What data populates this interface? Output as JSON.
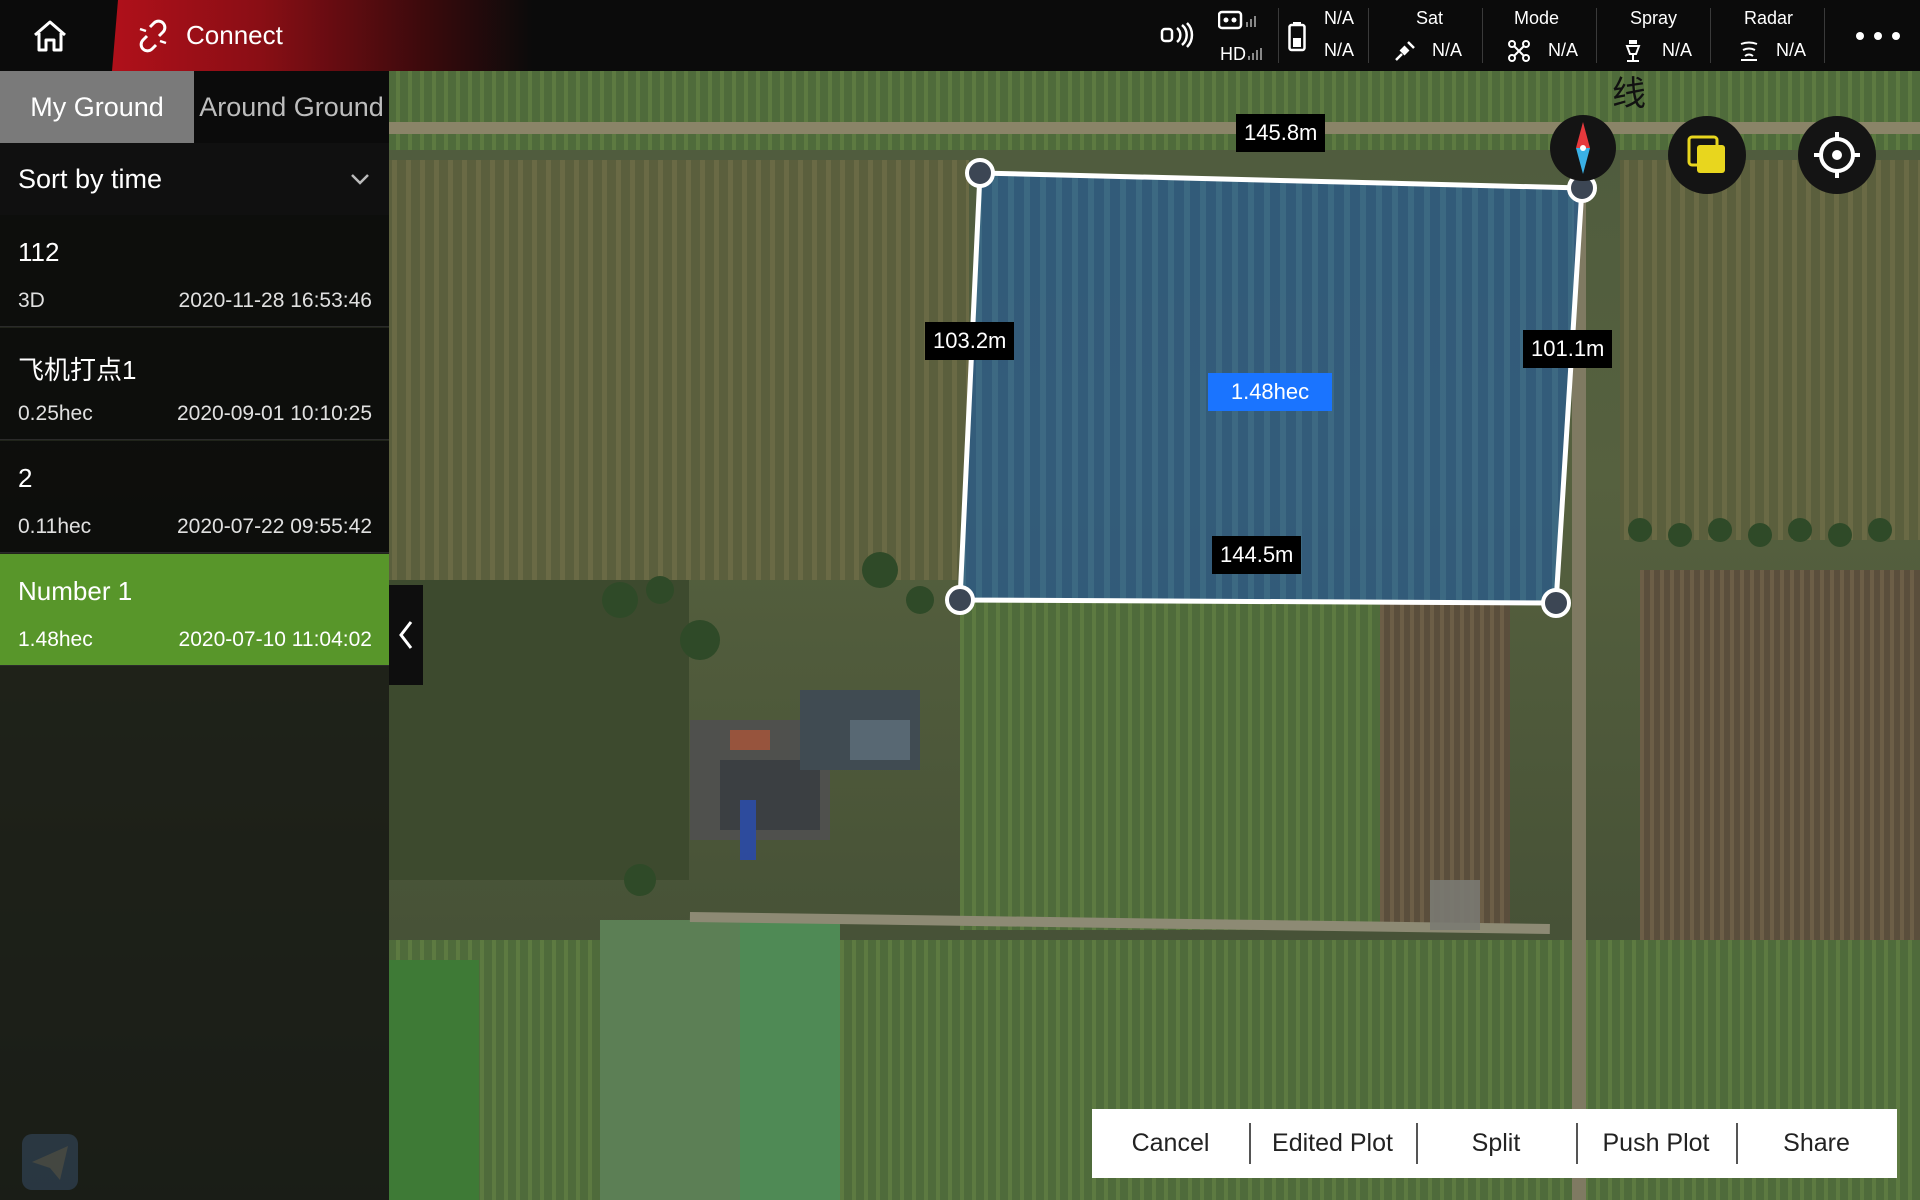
{
  "topbar": {
    "home_icon": "home-icon",
    "connect_label": "Connect",
    "rc_hd": "HD",
    "battery_top": "N/A",
    "battery_bottom": "N/A",
    "sat_label": "Sat",
    "sat_value": "N/A",
    "mode_label": "Mode",
    "mode_value": "N/A",
    "spray_label": "Spray",
    "spray_value": "N/A",
    "radar_label": "Radar",
    "radar_value": "N/A",
    "more_icon": "more-dots-icon"
  },
  "sidebar": {
    "tabs": [
      {
        "label": "My Ground",
        "active": true
      },
      {
        "label": "Around Ground",
        "active": false
      }
    ],
    "sort_label": "Sort by time",
    "plots": [
      {
        "name": "112",
        "area": "3D",
        "date": "2020-11-28 16:53:46",
        "selected": false
      },
      {
        "name": "飞机打点1",
        "area": "0.25hec",
        "date": "2020-09-01 10:10:25",
        "selected": false
      },
      {
        "name": "2",
        "area": "0.11hec",
        "date": "2020-07-22 09:55:42",
        "selected": false
      },
      {
        "name": "Number 1",
        "area": "1.48hec",
        "date": "2020-07-10 11:04:02",
        "selected": true
      }
    ]
  },
  "map": {
    "edge_top": "145.8m",
    "edge_left": "103.2m",
    "edge_right": "101.1m",
    "edge_bottom": "144.5m",
    "area": "1.48hec",
    "map_text": "线",
    "plot_fill_color": "#2e5a86",
    "selected_color": "#58962a",
    "accent_blue": "#1a74ff"
  },
  "actions": {
    "cancel": "Cancel",
    "edited_plot": "Edited Plot",
    "split": "Split",
    "push_plot": "Push Plot",
    "share": "Share"
  }
}
